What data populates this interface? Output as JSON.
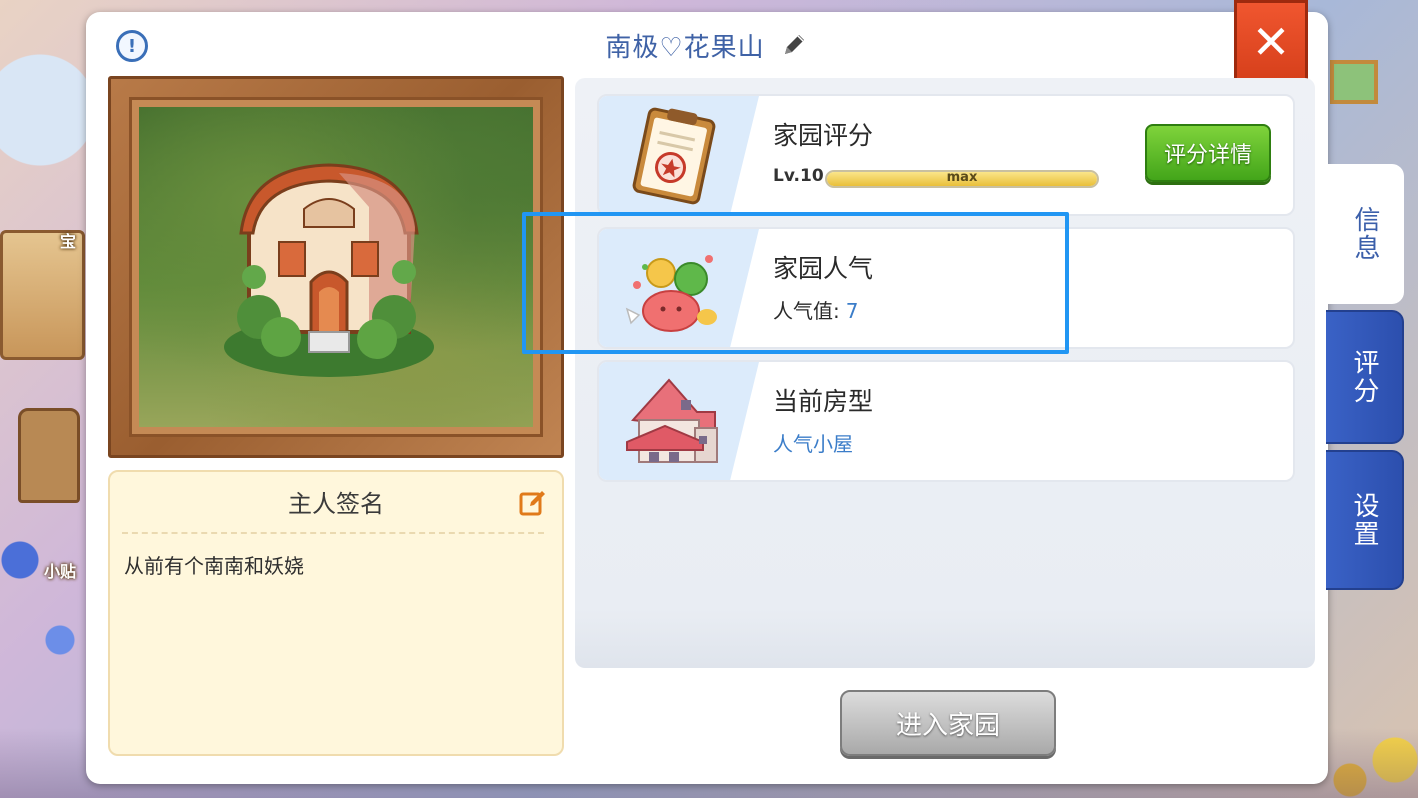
{
  "header": {
    "title": "南极♡花果山"
  },
  "close_button": {
    "label": "✕"
  },
  "signature": {
    "title": "主人签名",
    "text": "从前有个南南和妖娆"
  },
  "cards": {
    "rating": {
      "title": "家园评分",
      "level_label": "Lv.10",
      "bar_text": "max",
      "bar_progress": 1.0,
      "button_label": "评分详情"
    },
    "popularity": {
      "title": "家园人气",
      "label": "人气值:",
      "value": "7"
    },
    "house_type": {
      "title": "当前房型",
      "value": "人气小屋"
    }
  },
  "enter_button": {
    "label": "进入家园"
  },
  "tabs": [
    {
      "label": "信息",
      "active": true
    },
    {
      "label": "评分",
      "active": false
    },
    {
      "label": "设置",
      "active": false
    }
  ],
  "background": {
    "label_left": "宝",
    "label_bottom": "小贴"
  },
  "colors": {
    "accent_blue": "#3b7dc9",
    "highlight": "#2196f3",
    "green_button": "#43a51a",
    "close_red": "#d23c18",
    "tab_blue": "#2c4fae"
  }
}
